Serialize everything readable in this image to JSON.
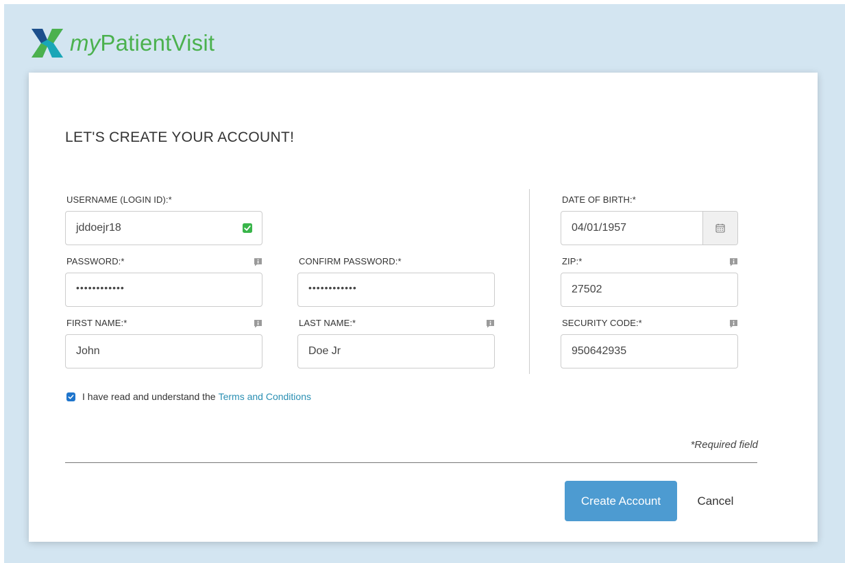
{
  "brand": {
    "prefix": "my",
    "name": "PatientVisit"
  },
  "page": {
    "heading": "LET'S CREATE YOUR ACCOUNT!"
  },
  "fields": {
    "username": {
      "label": "USERNAME (LOGIN ID):*",
      "value": "jddoejr18"
    },
    "password": {
      "label": "PASSWORD:*",
      "value": "••••••••••••"
    },
    "confirm_password": {
      "label": "CONFIRM PASSWORD:*",
      "value": "••••••••••••"
    },
    "first_name": {
      "label": "FIRST NAME:*",
      "value": "John"
    },
    "last_name": {
      "label": "LAST NAME:*",
      "value": "Doe Jr"
    },
    "dob": {
      "label": "DATE OF BIRTH:*",
      "value": "04/01/1957"
    },
    "zip": {
      "label": "ZIP:*",
      "value": "27502"
    },
    "security_code": {
      "label": "SECURITY CODE:*",
      "value": "950642935"
    }
  },
  "terms": {
    "text": "I have read and understand the",
    "link": "Terms and Conditions",
    "checked": true
  },
  "required_note": "*Required field",
  "actions": {
    "create": "Create Account",
    "cancel": "Cancel"
  },
  "colors": {
    "background": "#d3e5f1",
    "brand_green": "#4bb14e",
    "primary_button": "#4d9bd1",
    "link": "#2a8fb3",
    "valid_green": "#39b54a"
  },
  "icons": {
    "info": "info-icon",
    "valid": "check-icon",
    "calendar": "calendar-icon"
  }
}
